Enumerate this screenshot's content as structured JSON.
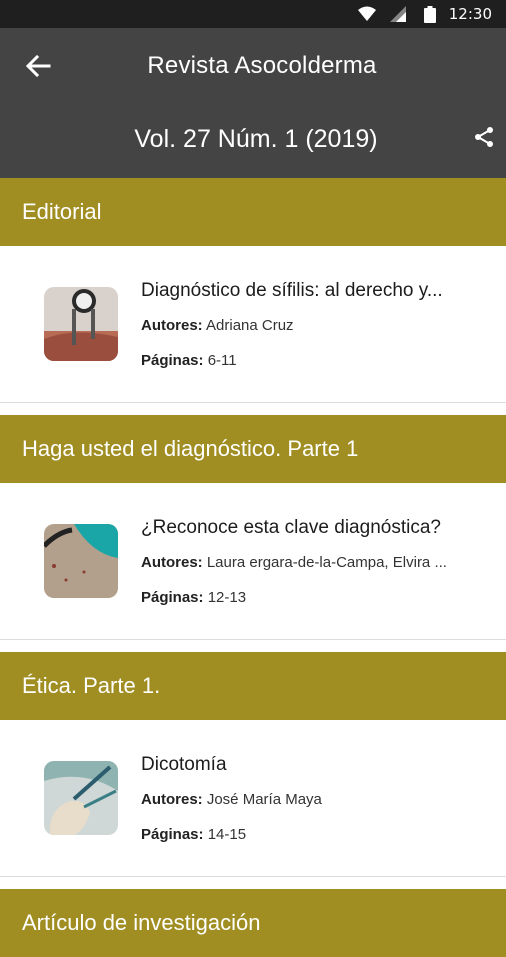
{
  "status_bar": {
    "time": "12:30"
  },
  "app_bar": {
    "title": "Revista Asocolderma",
    "issue": "Vol. 27 Núm. 1 (2019)"
  },
  "authors_label": "Autores:",
  "pages_label": "Páginas:",
  "sections": [
    {
      "title": "Editorial",
      "article": {
        "title": "Diagnóstico de sífilis: al derecho y...",
        "authors": "Adriana Cruz",
        "pages": "6-11"
      }
    },
    {
      "title": "Haga usted el diagnóstico. Parte 1",
      "article": {
        "title": "¿Reconoce esta clave diagnóstica?",
        "authors": "Laura ergara-de-la-Campa, Elvira ...",
        "pages": "12-13"
      }
    },
    {
      "title": "Ética. Parte 1.",
      "article": {
        "title": "Dicotomía",
        "authors": "José María Maya",
        "pages": "14-15"
      }
    },
    {
      "title": "Artículo de investigación"
    }
  ],
  "colors": {
    "app_bar": "#444444",
    "section_header": "#a08e22",
    "status_bar": "#1f1f1f"
  }
}
